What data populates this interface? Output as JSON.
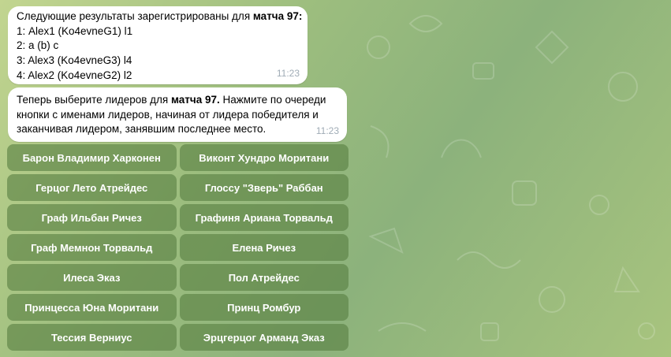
{
  "messages": [
    {
      "lines": {
        "l1_pre": "Следующие результаты зарегистрированы для ",
        "l1_bold": "матча 97:",
        "l2": "1: Alex1 (Ko4evneG1) l1",
        "l3": "2: a (b) c",
        "l4": "3: Alex3 (Ko4evneG3) l4",
        "l5": "4: Alex2 (Ko4evneG2) l2"
      },
      "time": "11:23"
    },
    {
      "parts": {
        "p1": "Теперь выберите лидеров для ",
        "p2_bold": "матча 97.",
        "p3": " Нажмите по очереди\nкнопки с именами лидеров, начиная от лидера победителя и\nзаканчивая лидером, занявшим последнее место."
      },
      "time": "11:23"
    }
  ],
  "keyboard": [
    [
      "Барон Владимир Харконен",
      "Виконт Хундро Моритани"
    ],
    [
      "Герцог Лето Атрейдес",
      "Глоссу \"Зверь\" Раббан"
    ],
    [
      "Граф Ильбан Ричез",
      "Графиня Ариана Торвальд"
    ],
    [
      "Граф Мемнон Торвальд",
      "Елена Ричез"
    ],
    [
      "Илеса Эказ",
      "Пол Атрейдес"
    ],
    [
      "Принцесса Юна Моритани",
      "Принц Ромбур"
    ],
    [
      "Тессия Верниус",
      "Эрцгерцог Арманд Эказ"
    ]
  ],
  "colors": {
    "background": "#9cbd7e",
    "bubble": "#ffffff",
    "time": "#a0acb6",
    "button": "#588042"
  }
}
